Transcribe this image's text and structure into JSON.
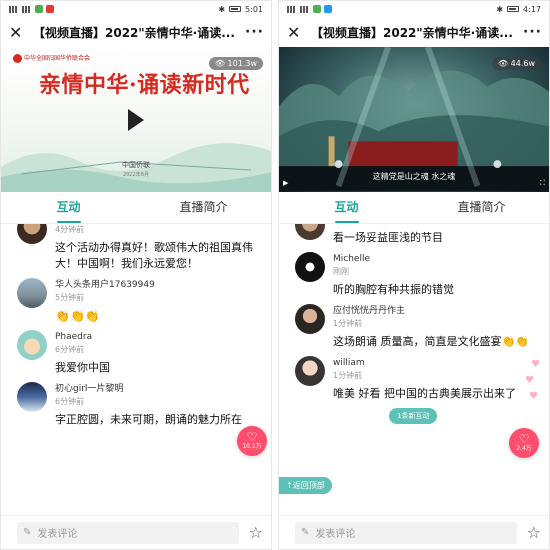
{
  "left": {
    "status": {
      "left_icons": "📶 ⟠ ◉",
      "time": "5:01",
      "battery": ""
    },
    "title": "【视频直播】2022\"亲情中华·诵读...",
    "video": {
      "views": "101.3w",
      "poster_header": "中华全国归国华侨联合会",
      "poster_title": "亲情中华·诵读新时代",
      "poster_org": "中国侨联",
      "poster_date": "2022年6月"
    },
    "tabs": [
      "互动",
      "直播简介"
    ],
    "comments": [
      {
        "name": "",
        "time": "4分钟前",
        "text": "这个活动办得真好！歌颂伟大的祖国真伟大！中国啊！我们永远爱您！"
      },
      {
        "name": "华人头条用户17639949",
        "time": "5分钟前",
        "text": "👏👏👏"
      },
      {
        "name": "Phaedra",
        "time": "6分钟前",
        "text": "我爱你中国"
      },
      {
        "name": "初心girl一片黎明",
        "time": "6分钟前",
        "text": "字正腔圆，未来可期，朗诵的魅力所在"
      }
    ],
    "like_count": "10.1万",
    "input_placeholder": "发表评论"
  },
  "right": {
    "status": {
      "time": "4:17"
    },
    "title": "【视频直播】2022\"亲情中华·诵读...",
    "video": {
      "views": "44.6w",
      "subtitle": "这精党是山之魂 水之魂"
    },
    "tabs": [
      "互动",
      "直播简介"
    ],
    "comments": [
      {
        "name": "",
        "time": "",
        "text": "看一场妥益匪浅的节目"
      },
      {
        "name": "Michelle",
        "time": "刚刚",
        "text": "听的胸腔有种共振的错觉"
      },
      {
        "name": "应付恍恍丹丹作主",
        "time": "1分钟前",
        "text": "这场朗诵 质量高，简直是文化盛宴👏👏"
      },
      {
        "name": "william",
        "time": "1分钟前",
        "text": "唯美 好看 把中国的古典美展示出来了"
      }
    ],
    "new_interactions": "1条新互动",
    "back_to_top": "↑返回顶部",
    "like_count": "2.4万",
    "input_placeholder": "发表评论"
  }
}
